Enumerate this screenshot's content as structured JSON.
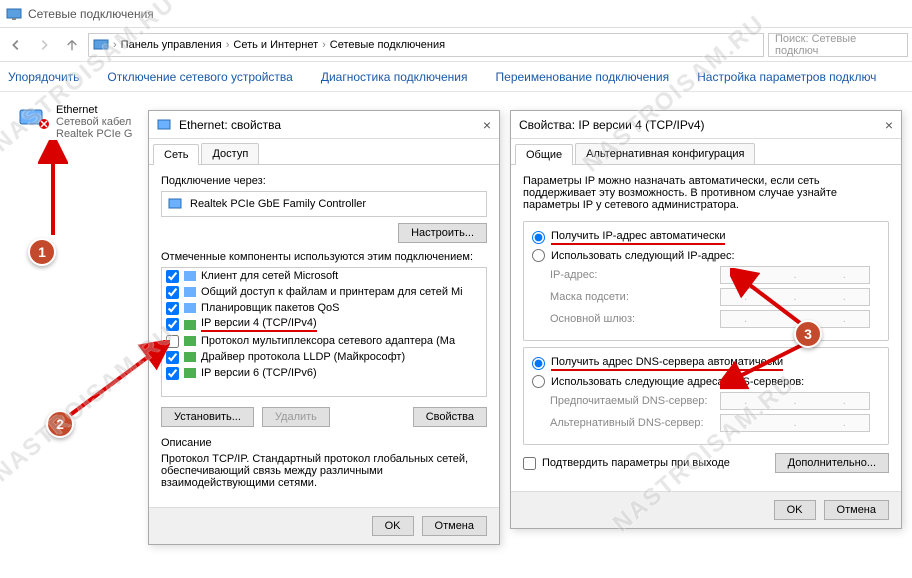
{
  "window": {
    "title": "Сетевые подключения"
  },
  "breadcrumb": {
    "p1": "Панель управления",
    "p2": "Сеть и Интернет",
    "p3": "Сетевые подключения"
  },
  "search": {
    "placeholder": "Поиск: Сетевые подключ"
  },
  "toolbar": {
    "organize": "Упорядочить",
    "disable": "Отключение сетевого устройства",
    "diagnose": "Диагностика подключения",
    "rename": "Переименование подключения",
    "settings": "Настройка параметров подключ"
  },
  "adapter": {
    "name": "Ethernet",
    "line2": "Сетевой кабел",
    "line3": "Realtek PCIe G"
  },
  "props": {
    "title": "Ethernet: свойства",
    "tab_net": "Сеть",
    "tab_access": "Доступ",
    "connect_via": "Подключение через:",
    "nic": "Realtek PCIe GbE Family Controller",
    "configure": "Настроить...",
    "components_label": "Отмеченные компоненты используются этим подключением:",
    "items": [
      "Клиент для сетей Microsoft",
      "Общий доступ к файлам и принтерам для сетей Mi",
      "Планировщик пакетов QoS",
      "IP версии 4 (TCP/IPv4)",
      "Протокол мультиплексора сетевого адаптера (Ма",
      "Драйвер протокола LLDP (Майкрософт)",
      "IP версии 6 (TCP/IPv6)"
    ],
    "install": "Установить...",
    "remove": "Удалить",
    "properties": "Свойства",
    "desc_label": "Описание",
    "desc_text": "Протокол TCP/IP. Стандартный протокол глобальных сетей, обеспечивающий связь между различными взаимодействующими сетями.",
    "ok": "OK",
    "cancel": "Отмена"
  },
  "ipv4": {
    "title": "Свойства: IP версии 4 (TCP/IPv4)",
    "tab_general": "Общие",
    "tab_alt": "Альтернативная конфигурация",
    "para": "Параметры IP можно назначать автоматически, если сеть поддерживает эту возможность. В противном случае узнайте параметры IP у сетевого администратора.",
    "ip_auto": "Получить IP-адрес автоматически",
    "ip_manual": "Использовать следующий IP-адрес:",
    "ip_label": "IP-адрес:",
    "mask_label": "Маска подсети:",
    "gw_label": "Основной шлюз:",
    "dns_auto": "Получить адрес DNS-сервера автоматически",
    "dns_manual": "Использовать следующие адреса DNS-серверов:",
    "dns1_label": "Предпочитаемый DNS-сервер:",
    "dns2_label": "Альтернативный DNS-сервер:",
    "confirm": "Подтвердить параметры при выходе",
    "advanced": "Дополнительно...",
    "ok": "OK",
    "cancel": "Отмена"
  },
  "markers": {
    "m1": "1",
    "m2": "2",
    "m3": "3"
  },
  "watermark": "NASTROISAM.RU"
}
